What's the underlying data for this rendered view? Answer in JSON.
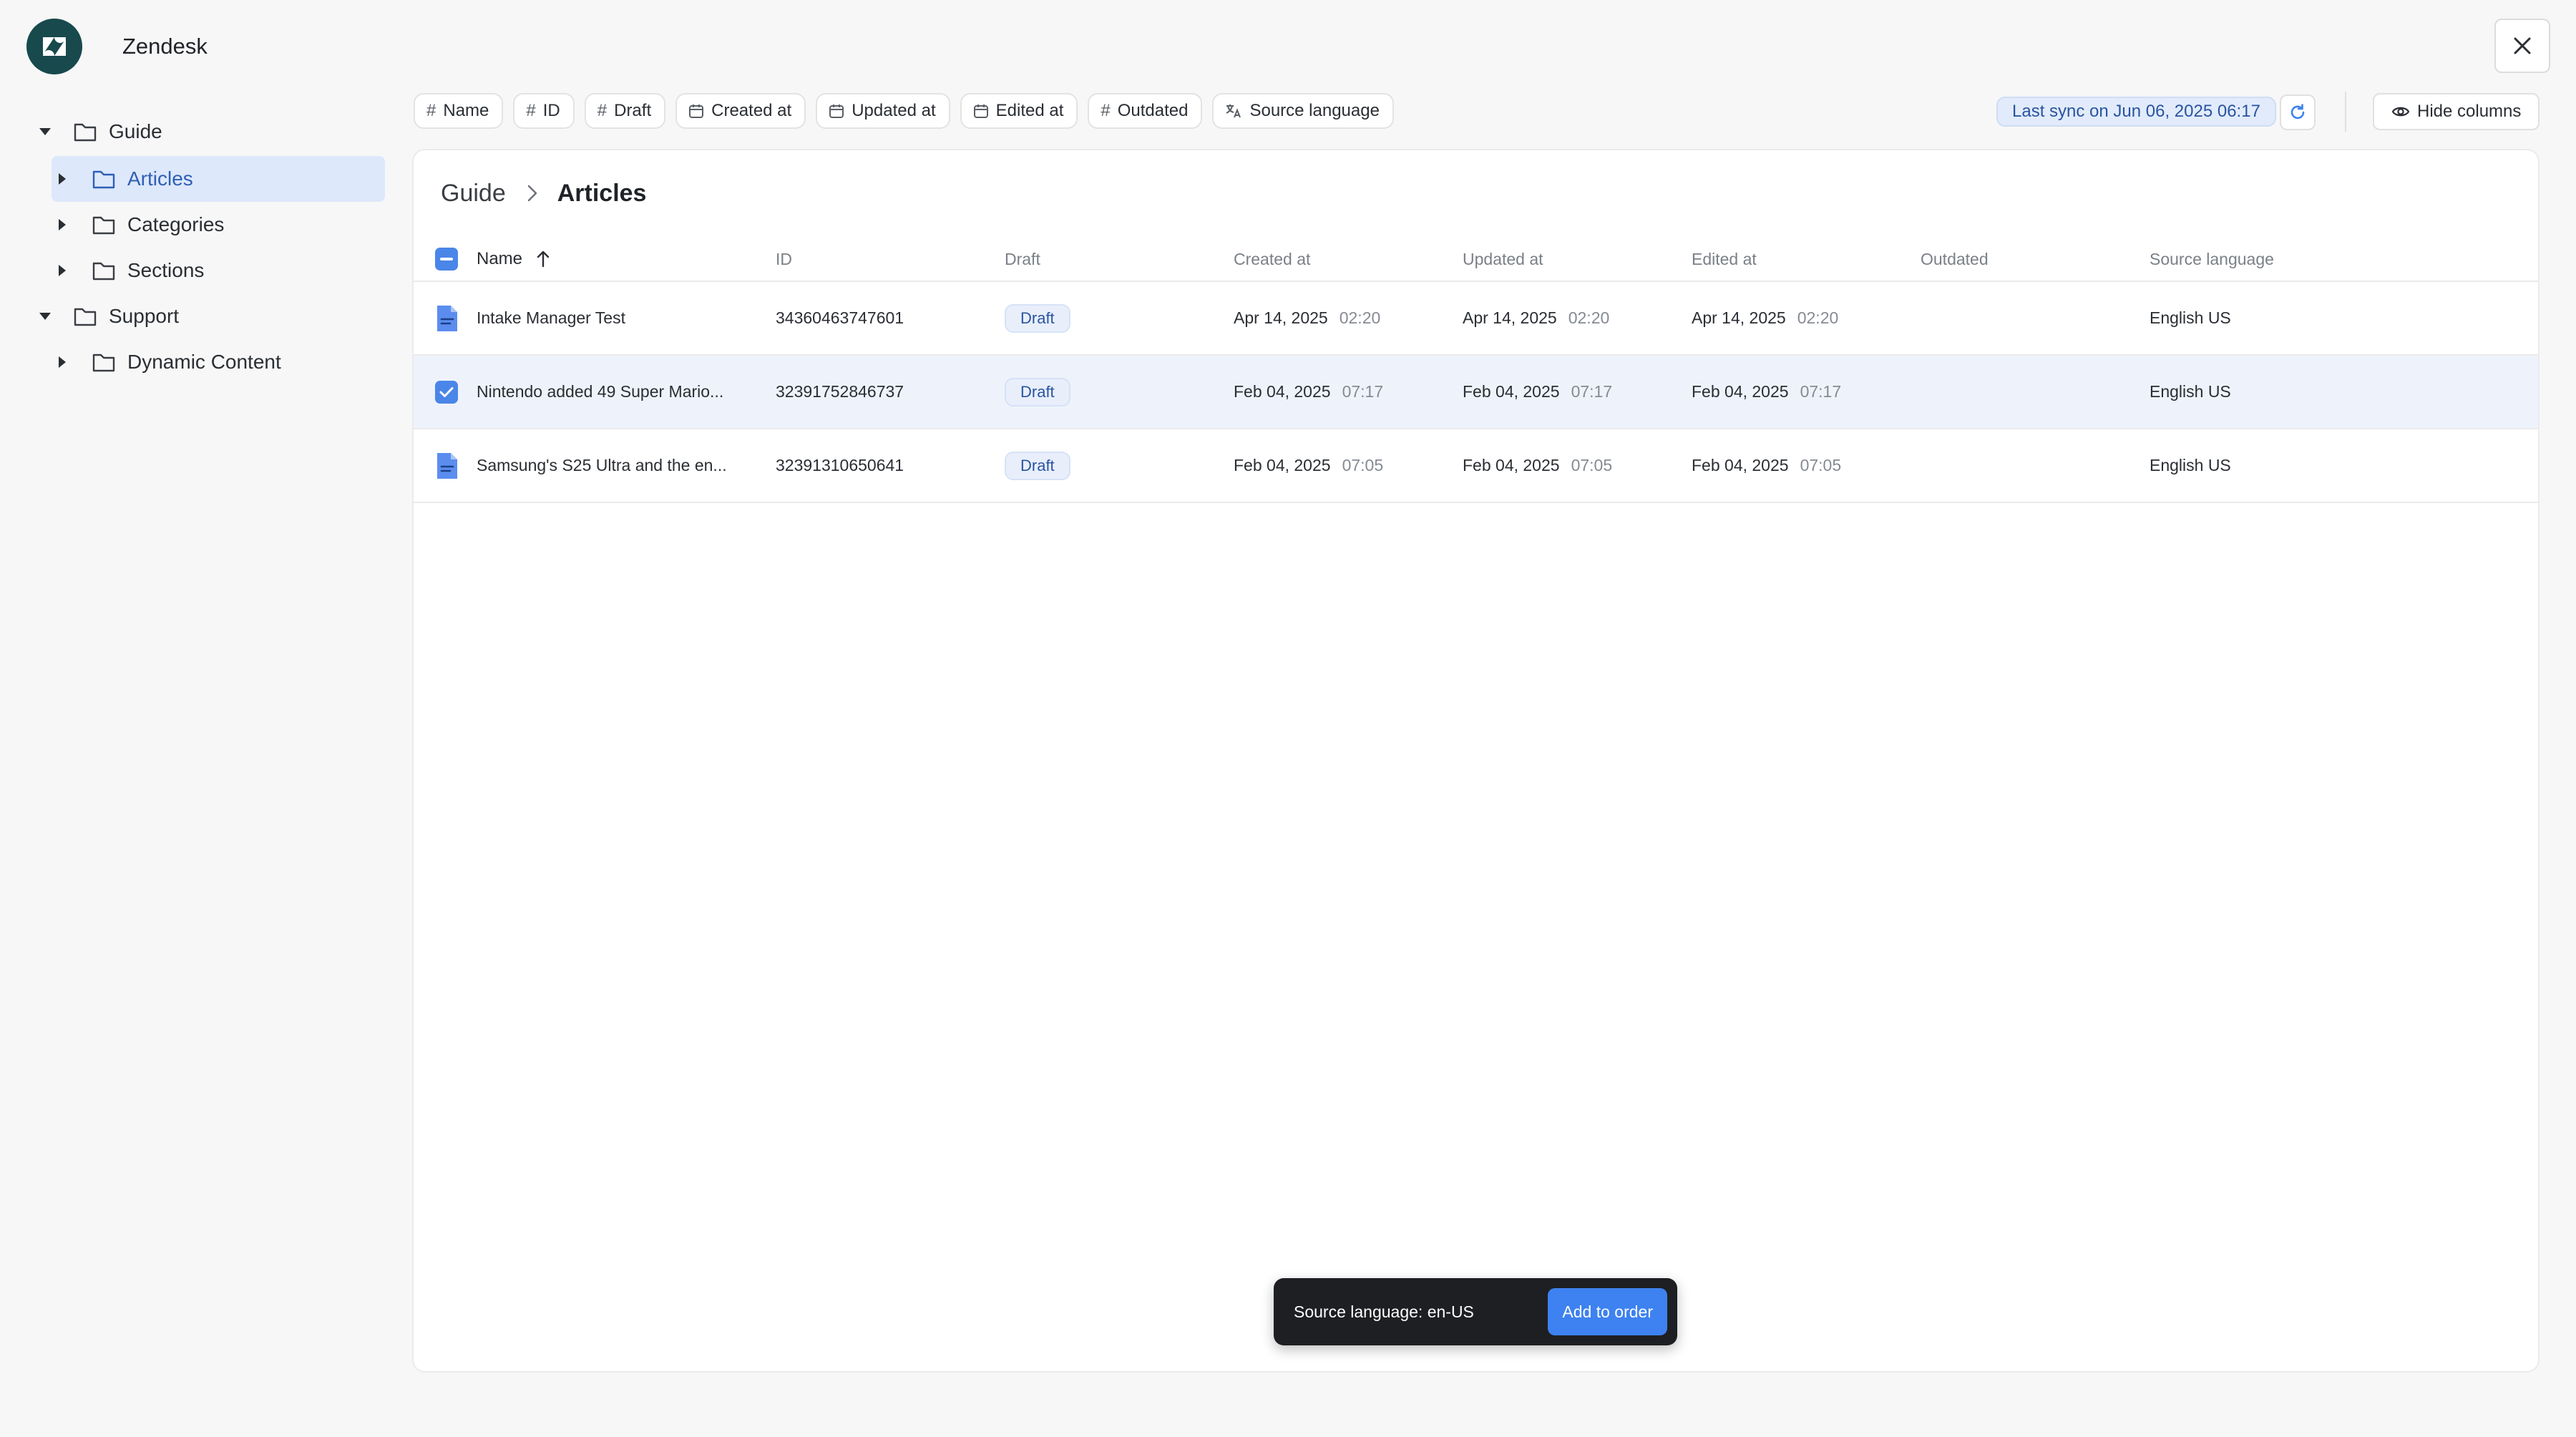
{
  "app": {
    "title": "Zendesk"
  },
  "tree": [
    {
      "label": "Guide",
      "expanded": true,
      "level": 0
    },
    {
      "label": "Articles",
      "expanded": false,
      "level": 1,
      "selected": true
    },
    {
      "label": "Categories",
      "expanded": false,
      "level": 1
    },
    {
      "label": "Sections",
      "expanded": false,
      "level": 1
    },
    {
      "label": "Support",
      "expanded": true,
      "level": 0
    },
    {
      "label": "Dynamic Content",
      "expanded": false,
      "level": 1
    }
  ],
  "column_chips": [
    {
      "label": "Name",
      "icon": "hash-icon"
    },
    {
      "label": "ID",
      "icon": "hash-icon"
    },
    {
      "label": "Draft",
      "icon": "hash-icon"
    },
    {
      "label": "Created at",
      "icon": "calendar-icon"
    },
    {
      "label": "Updated at",
      "icon": "calendar-icon"
    },
    {
      "label": "Edited at",
      "icon": "calendar-icon"
    },
    {
      "label": "Outdated",
      "icon": "hash-icon"
    },
    {
      "label": "Source language",
      "icon": "translate-icon"
    }
  ],
  "sync": {
    "label": "Last sync on Jun 06, 2025 06:17"
  },
  "hide_columns": {
    "label": "Hide columns"
  },
  "breadcrumb": {
    "parent": "Guide",
    "current": "Articles"
  },
  "table": {
    "headers": {
      "name": "Name",
      "id": "ID",
      "draft": "Draft",
      "created": "Created at",
      "updated": "Updated at",
      "edited": "Edited at",
      "outdated": "Outdated",
      "lang": "Source language"
    },
    "sort": {
      "column": "Name",
      "direction": "ascending"
    },
    "rows": [
      {
        "name": "Intake Manager Test",
        "id": "34360463747601",
        "draft": "Draft",
        "created_date": "Apr 14, 2025",
        "created_time": "02:20",
        "updated_date": "Apr 14, 2025",
        "updated_time": "02:20",
        "edited_date": "Apr 14, 2025",
        "edited_time": "02:20",
        "outdated": "",
        "lang": "English US",
        "selected": false
      },
      {
        "name": "Nintendo added 49 Super Mario...",
        "id": "32391752846737",
        "draft": "Draft",
        "created_date": "Feb 04, 2025",
        "created_time": "07:17",
        "updated_date": "Feb 04, 2025",
        "updated_time": "07:17",
        "edited_date": "Feb 04, 2025",
        "edited_time": "07:17",
        "outdated": "",
        "lang": "English US",
        "selected": true
      },
      {
        "name": "Samsung's S25 Ultra and the en...",
        "id": "32391310650641",
        "draft": "Draft",
        "created_date": "Feb 04, 2025",
        "created_time": "07:05",
        "updated_date": "Feb 04, 2025",
        "updated_time": "07:05",
        "edited_date": "Feb 04, 2025",
        "edited_time": "07:05",
        "outdated": "",
        "lang": "English US",
        "selected": false
      }
    ]
  },
  "toast": {
    "text": "Source language: en-US",
    "button": "Add to order"
  },
  "colors": {
    "accent": "#4a86e8",
    "logo_bg": "#17494d",
    "toast_bg": "#1e1f22"
  }
}
